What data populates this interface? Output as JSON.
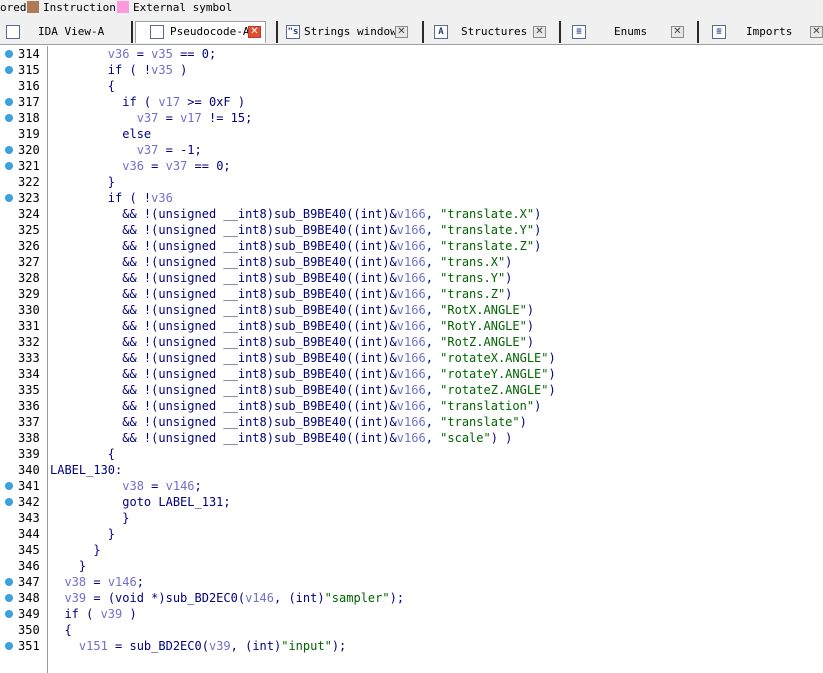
{
  "legend": {
    "items": [
      {
        "label": "ored",
        "color": ""
      },
      {
        "label": "Instruction",
        "color": "#b07a55"
      },
      {
        "label": "External symbol",
        "color": "#ff99dd"
      }
    ]
  },
  "tabs": [
    {
      "label": "IDA View-A",
      "icon": "ida-view-icon",
      "glyph": "",
      "active": false
    },
    {
      "label": "Pseudocode-A",
      "icon": "pseudocode-icon",
      "glyph": "",
      "active": true
    },
    {
      "label": "Strings window",
      "icon": "strings-icon",
      "glyph": "\"s",
      "active": false
    },
    {
      "label": "Structures",
      "icon": "structures-icon",
      "glyph": "A",
      "active": false
    },
    {
      "label": "Enums",
      "icon": "enums-icon",
      "glyph": "≡",
      "active": false
    },
    {
      "label": "Imports",
      "icon": "imports-icon",
      "glyph": "≡",
      "active": false
    }
  ],
  "colors": {
    "variable": "#7070cc",
    "string": "#006400",
    "code": "#000080",
    "breakpoint": "#3aa0e0",
    "active_close": "#e05030"
  },
  "code_lines": [
    {
      "num": "314",
      "bp": true,
      "tokens": [
        [
          "p",
          "        "
        ],
        [
          "v",
          "v36"
        ],
        [
          "p",
          " = "
        ],
        [
          "v",
          "v35"
        ],
        [
          "p",
          " == 0;"
        ]
      ]
    },
    {
      "num": "315",
      "bp": true,
      "tokens": [
        [
          "p",
          "        if ( !"
        ],
        [
          "v",
          "v35"
        ],
        [
          "p",
          " )"
        ]
      ]
    },
    {
      "num": "316",
      "bp": false,
      "tokens": [
        [
          "p",
          "        {"
        ]
      ]
    },
    {
      "num": "317",
      "bp": true,
      "tokens": [
        [
          "p",
          "          if ( "
        ],
        [
          "v",
          "v17"
        ],
        [
          "p",
          " >= 0xF )"
        ]
      ]
    },
    {
      "num": "318",
      "bp": true,
      "tokens": [
        [
          "p",
          "            "
        ],
        [
          "v",
          "v37"
        ],
        [
          "p",
          " = "
        ],
        [
          "v",
          "v17"
        ],
        [
          "p",
          " != 15;"
        ]
      ]
    },
    {
      "num": "319",
      "bp": false,
      "tokens": [
        [
          "p",
          "          else"
        ]
      ]
    },
    {
      "num": "320",
      "bp": true,
      "tokens": [
        [
          "p",
          "            "
        ],
        [
          "v",
          "v37"
        ],
        [
          "p",
          " = -1;"
        ]
      ]
    },
    {
      "num": "321",
      "bp": true,
      "tokens": [
        [
          "p",
          "          "
        ],
        [
          "v",
          "v36"
        ],
        [
          "p",
          " = "
        ],
        [
          "v",
          "v37"
        ],
        [
          "p",
          " == 0;"
        ]
      ]
    },
    {
      "num": "322",
      "bp": false,
      "tokens": [
        [
          "p",
          "        }"
        ]
      ]
    },
    {
      "num": "323",
      "bp": true,
      "tokens": [
        [
          "p",
          "        if ( !"
        ],
        [
          "v",
          "v36"
        ]
      ]
    },
    {
      "num": "324",
      "bp": false,
      "tokens": [
        [
          "p",
          "          && !(unsigned __int8)sub_B9BE40((int)&"
        ],
        [
          "v",
          "v166"
        ],
        [
          "p",
          ", "
        ],
        [
          "s",
          "\"translate.X\""
        ],
        [
          "p",
          ")"
        ]
      ]
    },
    {
      "num": "325",
      "bp": false,
      "tokens": [
        [
          "p",
          "          && !(unsigned __int8)sub_B9BE40((int)&"
        ],
        [
          "v",
          "v166"
        ],
        [
          "p",
          ", "
        ],
        [
          "s",
          "\"translate.Y\""
        ],
        [
          "p",
          ")"
        ]
      ]
    },
    {
      "num": "326",
      "bp": false,
      "tokens": [
        [
          "p",
          "          && !(unsigned __int8)sub_B9BE40((int)&"
        ],
        [
          "v",
          "v166"
        ],
        [
          "p",
          ", "
        ],
        [
          "s",
          "\"translate.Z\""
        ],
        [
          "p",
          ")"
        ]
      ]
    },
    {
      "num": "327",
      "bp": false,
      "tokens": [
        [
          "p",
          "          && !(unsigned __int8)sub_B9BE40((int)&"
        ],
        [
          "v",
          "v166"
        ],
        [
          "p",
          ", "
        ],
        [
          "s",
          "\"trans.X\""
        ],
        [
          "p",
          ")"
        ]
      ]
    },
    {
      "num": "328",
      "bp": false,
      "tokens": [
        [
          "p",
          "          && !(unsigned __int8)sub_B9BE40((int)&"
        ],
        [
          "v",
          "v166"
        ],
        [
          "p",
          ", "
        ],
        [
          "s",
          "\"trans.Y\""
        ],
        [
          "p",
          ")"
        ]
      ]
    },
    {
      "num": "329",
      "bp": false,
      "tokens": [
        [
          "p",
          "          && !(unsigned __int8)sub_B9BE40((int)&"
        ],
        [
          "v",
          "v166"
        ],
        [
          "p",
          ", "
        ],
        [
          "s",
          "\"trans.Z\""
        ],
        [
          "p",
          ")"
        ]
      ]
    },
    {
      "num": "330",
      "bp": false,
      "tokens": [
        [
          "p",
          "          && !(unsigned __int8)sub_B9BE40((int)&"
        ],
        [
          "v",
          "v166"
        ],
        [
          "p",
          ", "
        ],
        [
          "s",
          "\"RotX.ANGLE\""
        ],
        [
          "p",
          ")"
        ]
      ]
    },
    {
      "num": "331",
      "bp": false,
      "tokens": [
        [
          "p",
          "          && !(unsigned __int8)sub_B9BE40((int)&"
        ],
        [
          "v",
          "v166"
        ],
        [
          "p",
          ", "
        ],
        [
          "s",
          "\"RotY.ANGLE\""
        ],
        [
          "p",
          ")"
        ]
      ]
    },
    {
      "num": "332",
      "bp": false,
      "tokens": [
        [
          "p",
          "          && !(unsigned __int8)sub_B9BE40((int)&"
        ],
        [
          "v",
          "v166"
        ],
        [
          "p",
          ", "
        ],
        [
          "s",
          "\"RotZ.ANGLE\""
        ],
        [
          "p",
          ")"
        ]
      ]
    },
    {
      "num": "333",
      "bp": false,
      "tokens": [
        [
          "p",
          "          && !(unsigned __int8)sub_B9BE40((int)&"
        ],
        [
          "v",
          "v166"
        ],
        [
          "p",
          ", "
        ],
        [
          "s",
          "\"rotateX.ANGLE\""
        ],
        [
          "p",
          ")"
        ]
      ]
    },
    {
      "num": "334",
      "bp": false,
      "tokens": [
        [
          "p",
          "          && !(unsigned __int8)sub_B9BE40((int)&"
        ],
        [
          "v",
          "v166"
        ],
        [
          "p",
          ", "
        ],
        [
          "s",
          "\"rotateY.ANGLE\""
        ],
        [
          "p",
          ")"
        ]
      ]
    },
    {
      "num": "335",
      "bp": false,
      "tokens": [
        [
          "p",
          "          && !(unsigned __int8)sub_B9BE40((int)&"
        ],
        [
          "v",
          "v166"
        ],
        [
          "p",
          ", "
        ],
        [
          "s",
          "\"rotateZ.ANGLE\""
        ],
        [
          "p",
          ")"
        ]
      ]
    },
    {
      "num": "336",
      "bp": false,
      "tokens": [
        [
          "p",
          "          && !(unsigned __int8)sub_B9BE40((int)&"
        ],
        [
          "v",
          "v166"
        ],
        [
          "p",
          ", "
        ],
        [
          "s",
          "\"translation\""
        ],
        [
          "p",
          ")"
        ]
      ]
    },
    {
      "num": "337",
      "bp": false,
      "tokens": [
        [
          "p",
          "          && !(unsigned __int8)sub_B9BE40((int)&"
        ],
        [
          "v",
          "v166"
        ],
        [
          "p",
          ", "
        ],
        [
          "s",
          "\"translate\""
        ],
        [
          "p",
          ")"
        ]
      ]
    },
    {
      "num": "338",
      "bp": false,
      "tokens": [
        [
          "p",
          "          && !(unsigned __int8)sub_B9BE40((int)&"
        ],
        [
          "v",
          "v166"
        ],
        [
          "p",
          ", "
        ],
        [
          "s",
          "\"scale\""
        ],
        [
          "p",
          ") )"
        ]
      ]
    },
    {
      "num": "339",
      "bp": false,
      "tokens": [
        [
          "p",
          "        {"
        ]
      ]
    },
    {
      "num": "340",
      "bp": false,
      "tokens": [
        [
          "p",
          "LABEL_130:"
        ]
      ]
    },
    {
      "num": "341",
      "bp": true,
      "tokens": [
        [
          "p",
          "          "
        ],
        [
          "v",
          "v38"
        ],
        [
          "p",
          " = "
        ],
        [
          "v",
          "v146"
        ],
        [
          "p",
          ";"
        ]
      ]
    },
    {
      "num": "342",
      "bp": true,
      "tokens": [
        [
          "p",
          "          goto LABEL_131;"
        ]
      ]
    },
    {
      "num": "343",
      "bp": false,
      "tokens": [
        [
          "p",
          "          }"
        ]
      ]
    },
    {
      "num": "344",
      "bp": false,
      "tokens": [
        [
          "p",
          "        }"
        ]
      ]
    },
    {
      "num": "345",
      "bp": false,
      "tokens": [
        [
          "p",
          "      }"
        ]
      ]
    },
    {
      "num": "346",
      "bp": false,
      "tokens": [
        [
          "p",
          "    }"
        ]
      ]
    },
    {
      "num": "347",
      "bp": true,
      "tokens": [
        [
          "p",
          "  "
        ],
        [
          "v",
          "v38"
        ],
        [
          "p",
          " = "
        ],
        [
          "v",
          "v146"
        ],
        [
          "p",
          ";"
        ]
      ]
    },
    {
      "num": "348",
      "bp": true,
      "tokens": [
        [
          "p",
          "  "
        ],
        [
          "v",
          "v39"
        ],
        [
          "p",
          " = (void *)sub_BD2EC0("
        ],
        [
          "v",
          "v146"
        ],
        [
          "p",
          ", (int)"
        ],
        [
          "s",
          "\"sampler\""
        ],
        [
          "p",
          ");"
        ]
      ]
    },
    {
      "num": "349",
      "bp": true,
      "tokens": [
        [
          "p",
          "  if ( "
        ],
        [
          "v",
          "v39"
        ],
        [
          "p",
          " )"
        ]
      ]
    },
    {
      "num": "350",
      "bp": false,
      "tokens": [
        [
          "p",
          "  {"
        ]
      ]
    },
    {
      "num": "351",
      "bp": true,
      "tokens": [
        [
          "p",
          "    "
        ],
        [
          "v",
          "v151"
        ],
        [
          "p",
          " = sub_BD2EC0("
        ],
        [
          "v",
          "v39"
        ],
        [
          "p",
          ", (int)"
        ],
        [
          "s",
          "\"input\""
        ],
        [
          "p",
          ");"
        ]
      ]
    }
  ]
}
